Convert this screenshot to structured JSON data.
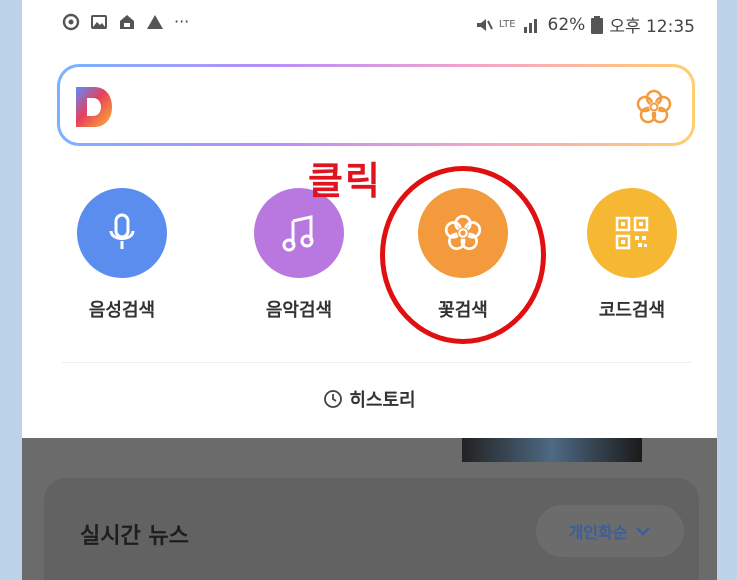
{
  "status": {
    "left_icons": [
      "threads-icon",
      "gallery-icon",
      "briefcase-icon",
      "warning-icon"
    ],
    "more": "···",
    "network": "LTE",
    "battery": "62%",
    "time": "오후 12:35"
  },
  "annotation": {
    "label": "클릭"
  },
  "tiles": [
    {
      "label": "음성검색",
      "icon": "microphone-icon",
      "color": "#5b8def"
    },
    {
      "label": "음악검색",
      "icon": "music-note-icon",
      "color": "#b878df"
    },
    {
      "label": "꽃검색",
      "icon": "flower-icon",
      "color": "#f39a3c"
    },
    {
      "label": "코드검색",
      "icon": "qr-code-icon",
      "color": "#f6b733"
    }
  ],
  "history": {
    "label": "히스토리"
  },
  "news": {
    "title": "실시간 뉴스",
    "sort_label": "개인화순"
  }
}
